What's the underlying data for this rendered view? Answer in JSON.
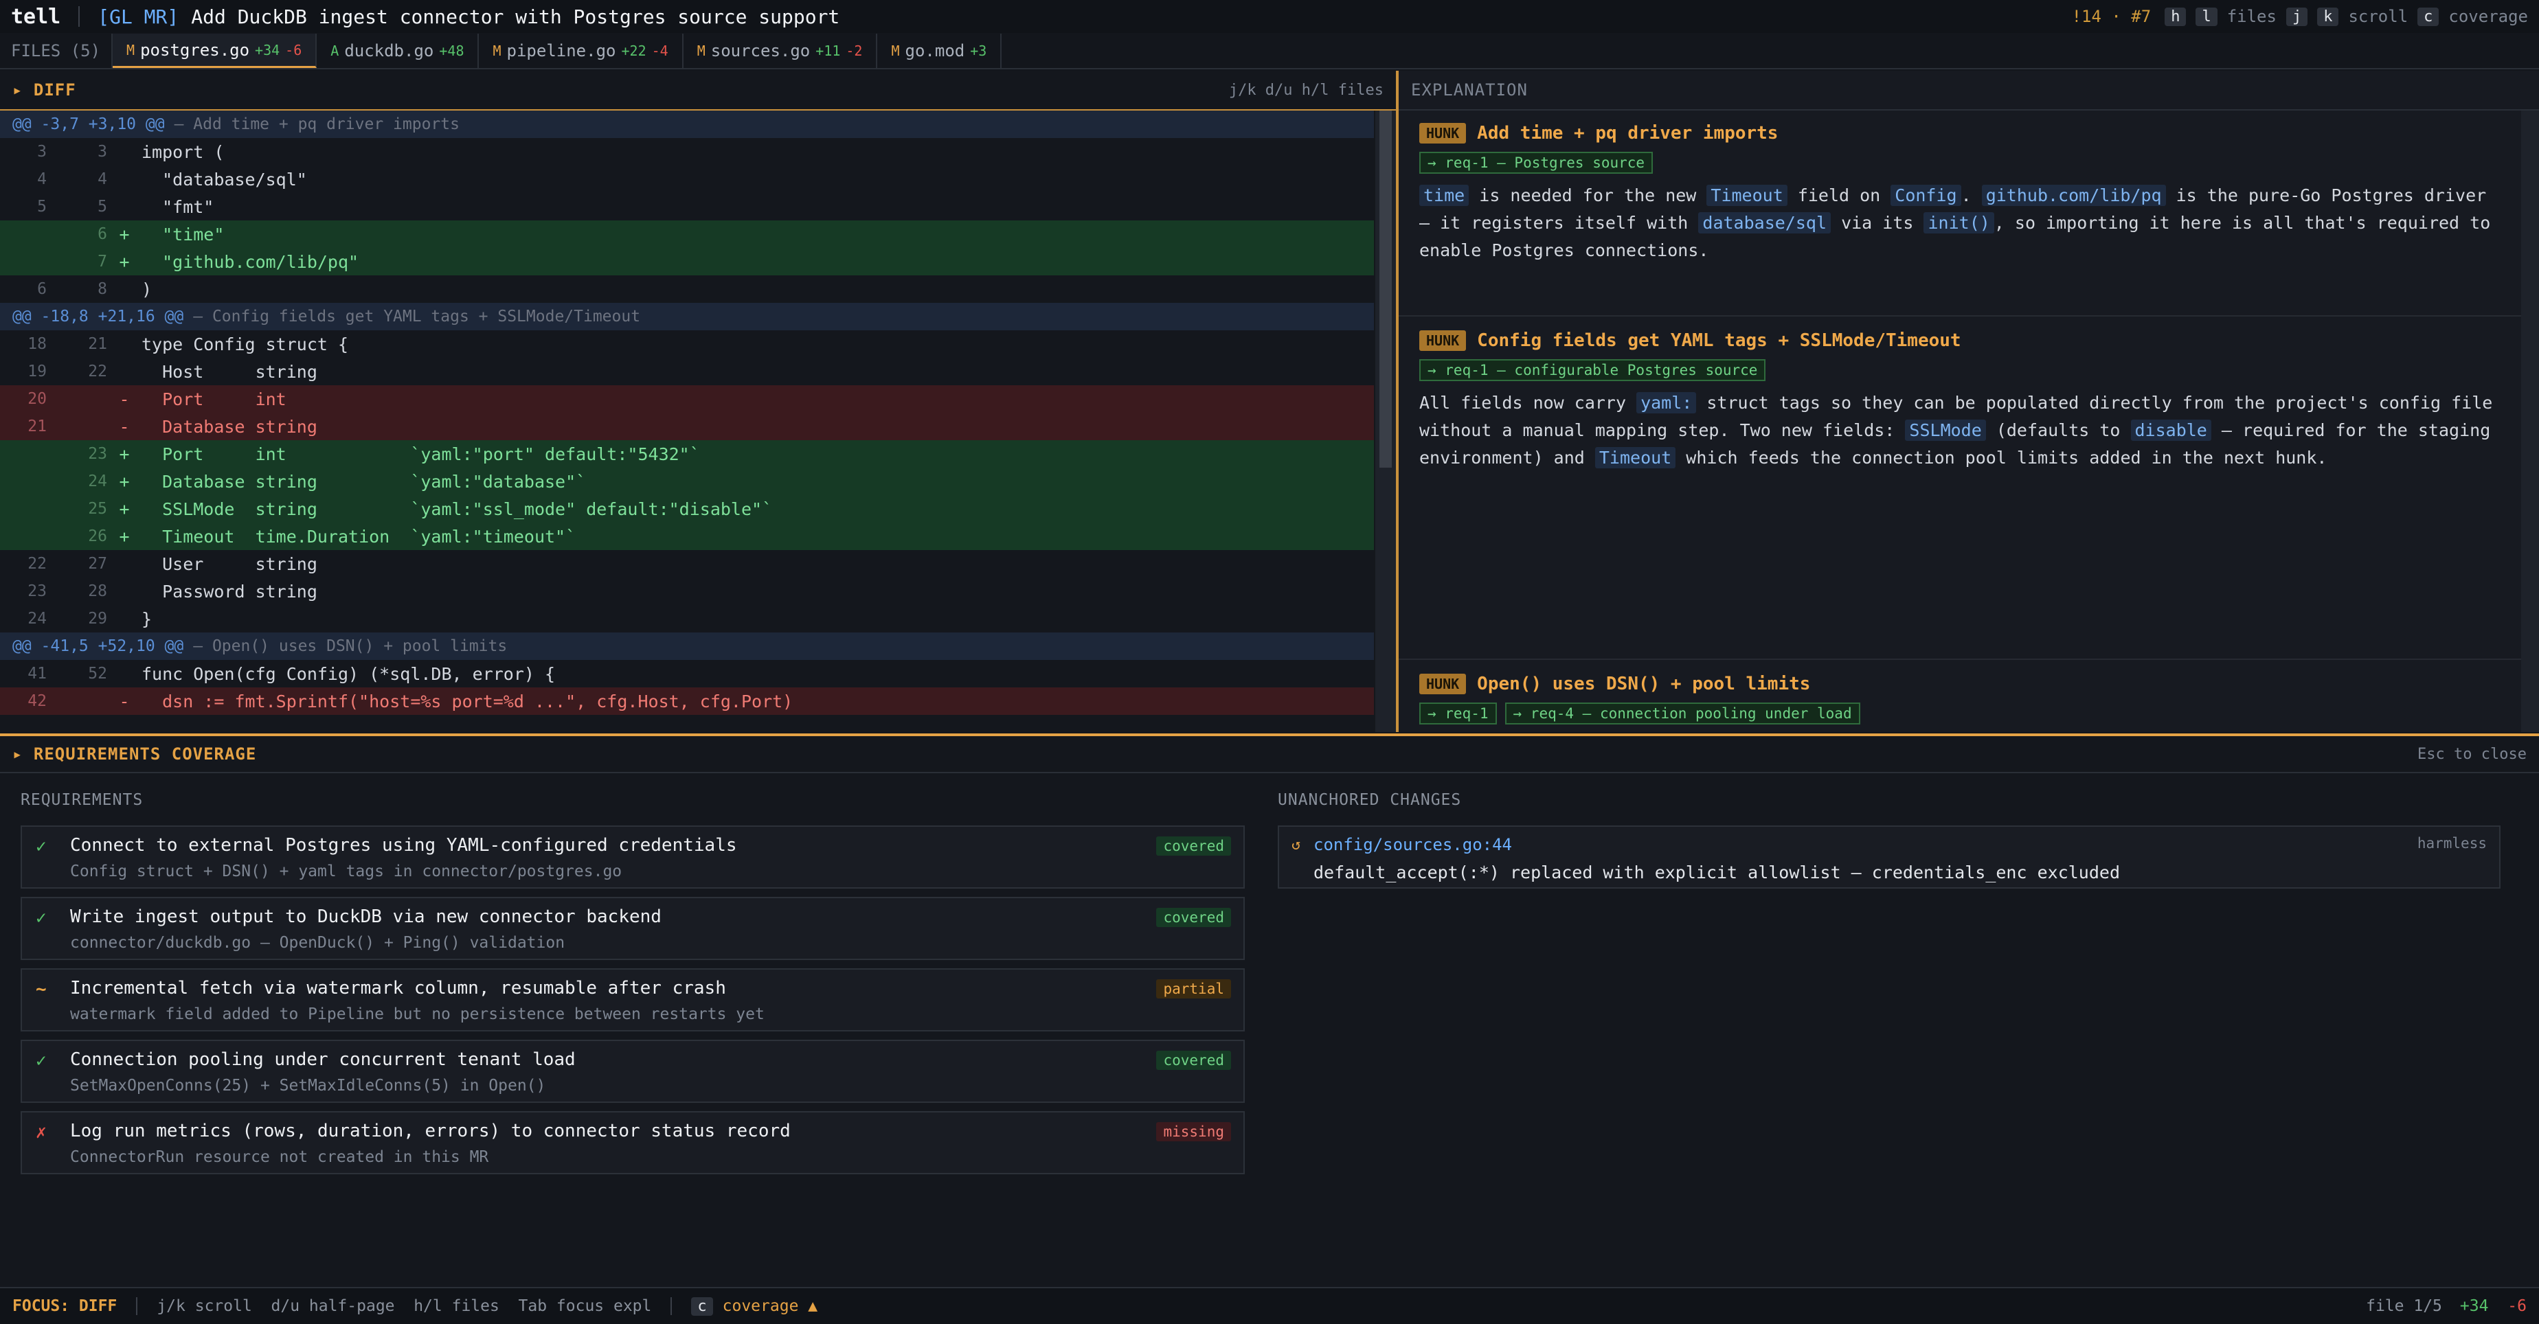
{
  "header": {
    "app_name": "tell",
    "mr_tag": "[GL MR]",
    "mr_title": "Add DuckDB ingest connector with Postgres source support",
    "count_a": "!14",
    "count_sep": "·",
    "count_b": "#7",
    "key_h": "h",
    "key_l": "l",
    "files_label": "files",
    "key_j": "j",
    "key_k": "k",
    "scroll_label": "scroll",
    "key_c": "c",
    "coverage_label": "coverage"
  },
  "tabs": {
    "count_label": "FILES (5)",
    "items": [
      {
        "status": "M",
        "name": "postgres.go",
        "added": "+34",
        "removed": "-6"
      },
      {
        "status": "A",
        "name": "duckdb.go",
        "added": "+48",
        "removed": ""
      },
      {
        "status": "M",
        "name": "pipeline.go",
        "added": "+22",
        "removed": "-4"
      },
      {
        "status": "M",
        "name": "sources.go",
        "added": "+11",
        "removed": "-2"
      },
      {
        "status": "M",
        "name": "go.mod",
        "added": "+3",
        "removed": ""
      }
    ]
  },
  "diff": {
    "title": "▸ DIFF",
    "hint": "j/k d/u h/l files",
    "lines": [
      {
        "type": "hunk",
        "header": "@@ -3,7 +3,10 @@",
        "desc": "— Add time + pq driver imports"
      },
      {
        "type": "ctx",
        "old": "3",
        "new": "3",
        "mark": "",
        "code": "import ("
      },
      {
        "type": "ctx",
        "old": "4",
        "new": "4",
        "mark": "",
        "code": "  \"database/sql\""
      },
      {
        "type": "ctx",
        "old": "5",
        "new": "5",
        "mark": "",
        "code": "  \"fmt\""
      },
      {
        "type": "add",
        "old": "",
        "new": "6",
        "mark": "+",
        "code": "  \"time\""
      },
      {
        "type": "add",
        "old": "",
        "new": "7",
        "mark": "+",
        "code": "  \"github.com/lib/pq\""
      },
      {
        "type": "ctx",
        "old": "6",
        "new": "8",
        "mark": "",
        "code": ")"
      },
      {
        "type": "hunk",
        "header": "@@ -18,8 +21,16 @@",
        "desc": "— Config fields get YAML tags + SSLMode/Timeout"
      },
      {
        "type": "ctx",
        "old": "18",
        "new": "21",
        "mark": "",
        "code": "type Config struct {"
      },
      {
        "type": "ctx",
        "old": "19",
        "new": "22",
        "mark": "",
        "code": "  Host     string"
      },
      {
        "type": "del",
        "old": "20",
        "new": "",
        "mark": "-",
        "code": "  Port     int"
      },
      {
        "type": "del",
        "old": "21",
        "new": "",
        "mark": "-",
        "code": "  Database string"
      },
      {
        "type": "add",
        "old": "",
        "new": "23",
        "mark": "+",
        "code": "  Port     int            `yaml:\"port\" default:\"5432\"`"
      },
      {
        "type": "add",
        "old": "",
        "new": "24",
        "mark": "+",
        "code": "  Database string         `yaml:\"database\"`"
      },
      {
        "type": "add",
        "old": "",
        "new": "25",
        "mark": "+",
        "code": "  SSLMode  string         `yaml:\"ssl_mode\" default:\"disable\"`"
      },
      {
        "type": "add",
        "old": "",
        "new": "26",
        "mark": "+",
        "code": "  Timeout  time.Duration  `yaml:\"timeout\"`"
      },
      {
        "type": "ctx",
        "old": "22",
        "new": "27",
        "mark": "",
        "code": "  User     string"
      },
      {
        "type": "ctx",
        "old": "23",
        "new": "28",
        "mark": "",
        "code": "  Password string"
      },
      {
        "type": "ctx",
        "old": "24",
        "new": "29",
        "mark": "",
        "code": "}"
      },
      {
        "type": "hunk",
        "header": "@@ -41,5 +52,10 @@",
        "desc": "— Open() uses DSN() + pool limits"
      },
      {
        "type": "ctx",
        "old": "41",
        "new": "52",
        "mark": "",
        "code": "func Open(cfg Config) (*sql.DB, error) {"
      },
      {
        "type": "del",
        "old": "42",
        "new": "",
        "mark": "-",
        "code": "  dsn := fmt.Sprintf(\"host=%s port=%d ...\", cfg.Host, cfg.Port)"
      }
    ]
  },
  "explanation": {
    "title": "EXPLANATION",
    "hunk_badge": "HUNK",
    "h1": {
      "title": "Add time + pq driver imports",
      "req": "→ req-1 — Postgres source",
      "t1": "time",
      "t2": " is needed for the new ",
      "t3": "Timeout",
      "t4": " field on ",
      "t5": "Config",
      "t6": ". ",
      "t7": "github.com/lib/pq",
      "t8": " is the pure-Go Postgres driver — it registers itself with ",
      "t9": "database/sql",
      "t10": " via its ",
      "t11": "init()",
      "t12": ", so importing it here is all that's required to enable Postgres connections."
    },
    "h2": {
      "title": "Config fields get YAML tags + SSLMode/Timeout",
      "req": "→ req-1 — configurable Postgres source",
      "t1": "All fields now carry ",
      "t2": "yaml:",
      "t3": " struct tags so they can be populated directly from the project's config file without a manual mapping step. Two new fields: ",
      "t4": "SSLMode",
      "t5": " (defaults to ",
      "t6": "disable",
      "t7": " — required for the staging environment) and ",
      "t8": "Timeout",
      "t9": " which feeds the connection pool limits added in the next hunk."
    },
    "h3": {
      "title": "Open() uses DSN() + pool limits",
      "req_a": "→ req-1",
      "req_b": "→ req-4 — connection pooling under load"
    }
  },
  "coverage": {
    "title": "▸ REQUIREMENTS COVERAGE",
    "hint": "Esc to close",
    "requirements_label": "REQUIREMENTS",
    "unanchored_label": "UNANCHORED CHANGES",
    "requirements": [
      {
        "mark": "✓",
        "status": "covered",
        "title": "Connect to external Postgres using YAML-configured credentials",
        "sub": "Config struct + DSN() + yaml tags in connector/postgres.go"
      },
      {
        "mark": "✓",
        "status": "covered",
        "title": "Write ingest output to DuckDB via new connector backend",
        "sub": "connector/duckdb.go — OpenDuck() + Ping() validation"
      },
      {
        "mark": "~",
        "status": "partial",
        "title": "Incremental fetch via watermark column, resumable after crash",
        "sub": "watermark field added to Pipeline but no persistence between restarts yet"
      },
      {
        "mark": "✓",
        "status": "covered",
        "title": "Connection pooling under concurrent tenant load",
        "sub": "SetMaxOpenConns(25) + SetMaxIdleConns(5) in Open()"
      },
      {
        "mark": "✗",
        "status": "missing",
        "title": "Log run metrics (rows, duration, errors) to connector status record",
        "sub": "ConnectorRun resource not created in this MR"
      }
    ],
    "unanchored": {
      "icon": "↺",
      "file": "config/sources.go:44",
      "desc": "default_accept(:*) replaced with explicit allowlist — credentials_enc excluded",
      "tag": "harmless"
    }
  },
  "statusbar": {
    "focus": "FOCUS: DIFF",
    "hints": "j/k scroll  d/u half-page  h/l files  Tab focus expl",
    "key_c": "c",
    "coverage_toggle": "coverage ▲",
    "file_pos": "file 1/5",
    "added": "+34",
    "removed": "-6"
  }
}
